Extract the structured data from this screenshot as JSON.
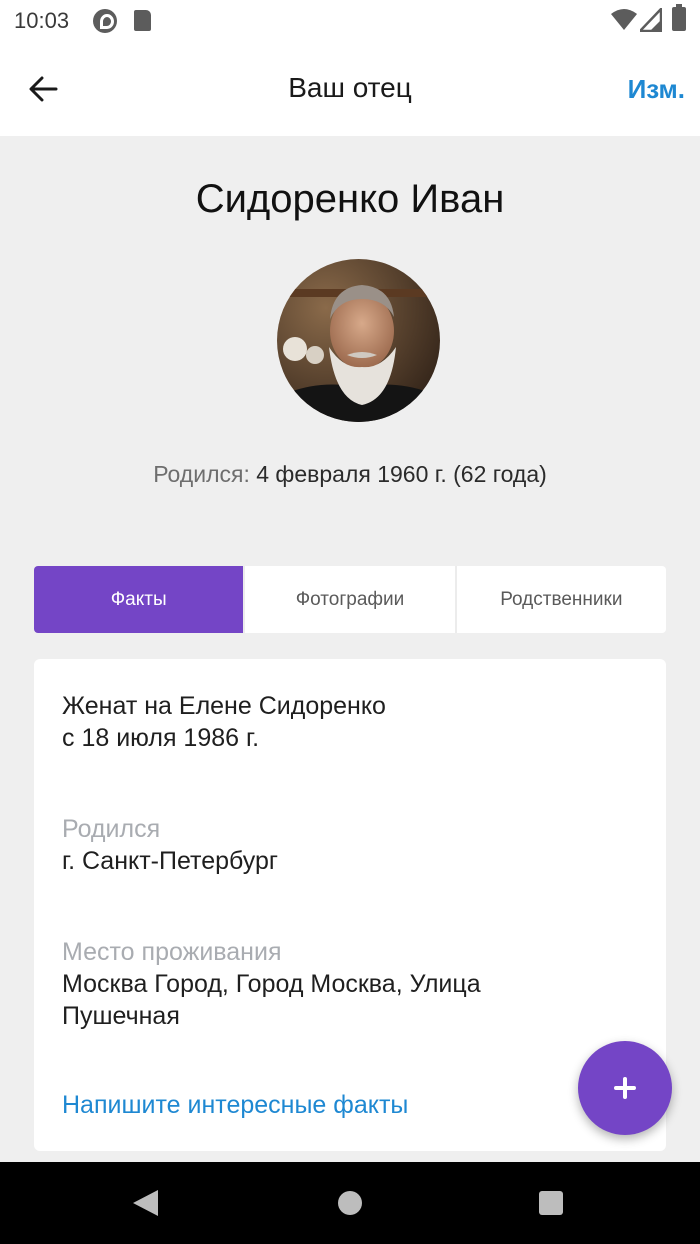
{
  "status_bar": {
    "time": "10:03"
  },
  "app_bar": {
    "title": "Ваш отец",
    "edit_label": "Изм."
  },
  "profile": {
    "name": "Сидоренко Иван",
    "birth_label": "Родился:",
    "birth_value": "4 февраля 1960 г. (62 года)"
  },
  "tabs": [
    {
      "label": "Факты",
      "active": true
    },
    {
      "label": "Фотографии",
      "active": false
    },
    {
      "label": "Родственники",
      "active": false
    }
  ],
  "facts": {
    "marriage": "Женат на Елене Сидоренко\nс 18 июля 1986 г.",
    "born_label": "Родился",
    "born_value": "г. Санкт-Петербург",
    "residence_label": "Место проживания",
    "residence_value": "Москва Город, Город Москва, Улица\nПушечная",
    "write_link": "Напишите интересные факты"
  },
  "colors": {
    "accent": "#7445c6",
    "link": "#1e88d2",
    "background": "#efefef"
  }
}
